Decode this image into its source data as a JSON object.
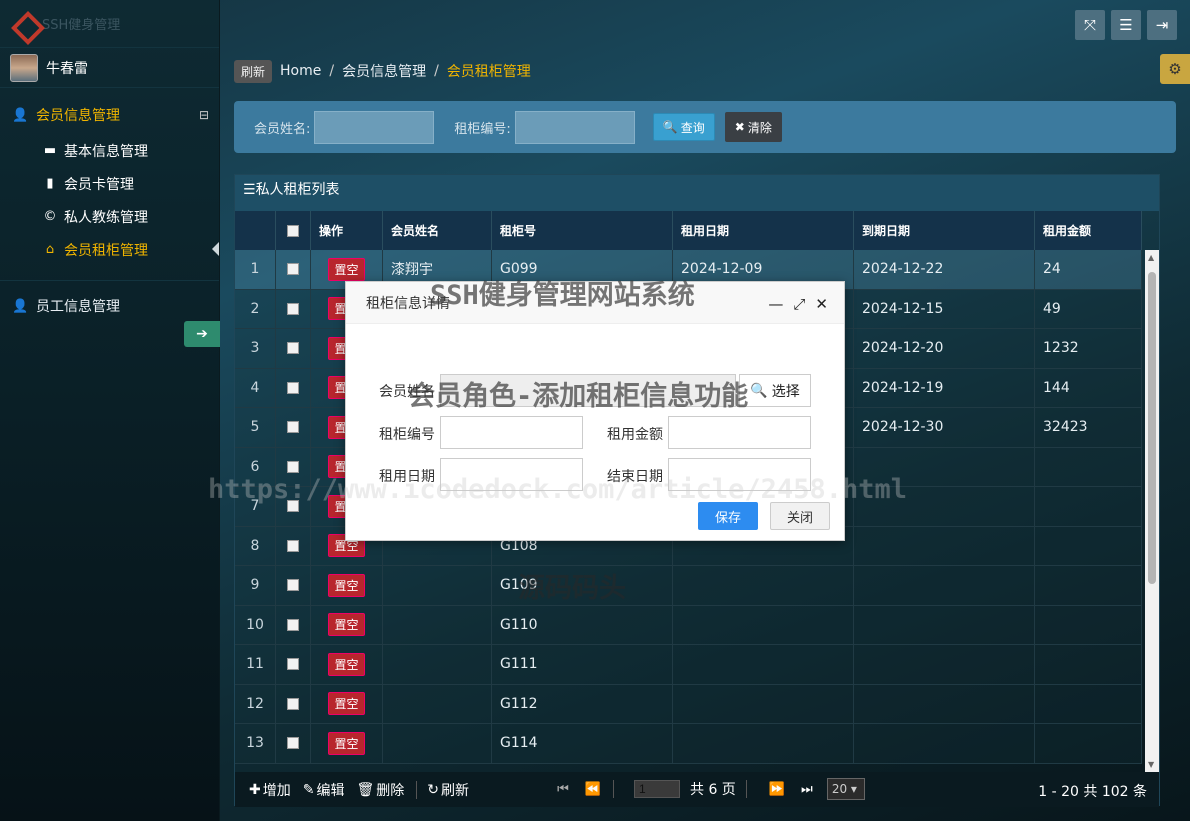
{
  "sidebar": {
    "logo_text": "SSH健身管理",
    "user_name": "牛春雷",
    "groups": [
      {
        "label": "会员信息管理",
        "collapse_icon": "⊟",
        "items": [
          {
            "label": "基本信息管理",
            "icon": "folder-icon"
          },
          {
            "label": "会员卡管理",
            "icon": "book-icon"
          },
          {
            "label": "私人教练管理",
            "icon": "copyright-icon"
          },
          {
            "label": "会员租柜管理",
            "icon": "home-icon"
          }
        ]
      },
      {
        "label": "员工信息管理"
      }
    ]
  },
  "breadcrumb": {
    "refresh": "刷新",
    "items": [
      "Home",
      "会员信息管理",
      "会员租柜管理"
    ]
  },
  "search": {
    "name_label": "会员姓名:",
    "locker_label": "租柜编号:",
    "query_label": "查询",
    "clear_label": "清除"
  },
  "grid": {
    "title": "私人租柜列表",
    "columns": [
      "操作",
      "会员姓名",
      "租柜号",
      "租用日期",
      "到期日期",
      "租用金额"
    ],
    "op_label": "置空",
    "rows": [
      {
        "num": "1",
        "name": "漆翔宇",
        "locker": "G099",
        "start": "2024-12-09",
        "end": "2024-12-22",
        "amount": "24"
      },
      {
        "num": "2",
        "name": "",
        "locker": "",
        "start": "",
        "end": "2024-12-15",
        "amount": "49"
      },
      {
        "num": "3",
        "name": "",
        "locker": "",
        "start": "",
        "end": "2024-12-20",
        "amount": "1232"
      },
      {
        "num": "4",
        "name": "",
        "locker": "",
        "start": "",
        "end": "2024-12-19",
        "amount": "144"
      },
      {
        "num": "5",
        "name": "",
        "locker": "",
        "start": "",
        "end": "2024-12-30",
        "amount": "32423"
      },
      {
        "num": "6",
        "name": "",
        "locker": "",
        "start": "",
        "end": "",
        "amount": ""
      },
      {
        "num": "7",
        "name": "",
        "locker": "",
        "start": "",
        "end": "",
        "amount": ""
      },
      {
        "num": "8",
        "name": "",
        "locker": "G108",
        "start": "",
        "end": "",
        "amount": ""
      },
      {
        "num": "9",
        "name": "",
        "locker": "G109",
        "start": "",
        "end": "",
        "amount": ""
      },
      {
        "num": "10",
        "name": "",
        "locker": "G110",
        "start": "",
        "end": "",
        "amount": ""
      },
      {
        "num": "11",
        "name": "",
        "locker": "G111",
        "start": "",
        "end": "",
        "amount": ""
      },
      {
        "num": "12",
        "name": "",
        "locker": "G112",
        "start": "",
        "end": "",
        "amount": ""
      },
      {
        "num": "13",
        "name": "",
        "locker": "G114",
        "start": "",
        "end": "",
        "amount": ""
      }
    ]
  },
  "toolbar": {
    "add": "增加",
    "edit": "编辑",
    "delete": "删除",
    "refresh": "刷新",
    "page_value": "1",
    "total_pages": "共 6 页",
    "page_size": "20",
    "info": "1 - 20   共 102 条"
  },
  "dialog": {
    "title": "租柜信息详情",
    "member_label": "会员姓名",
    "select_label": "选择",
    "locker_label": "租柜编号",
    "amount_label": "租用金额",
    "start_label": "租用日期",
    "end_label": "结束日期",
    "save_label": "保存",
    "close_label": "关闭"
  },
  "watermarks": {
    "line1": "SSH健身管理网站系统",
    "line2": "会员角色-添加租柜信息功能",
    "line3": "https://www.icodedock.com/article/2458.html",
    "line4": "源码码头"
  },
  "colors": {
    "accent": "#f0b400",
    "danger": "#b8262d",
    "primary": "#2d8cf0"
  }
}
